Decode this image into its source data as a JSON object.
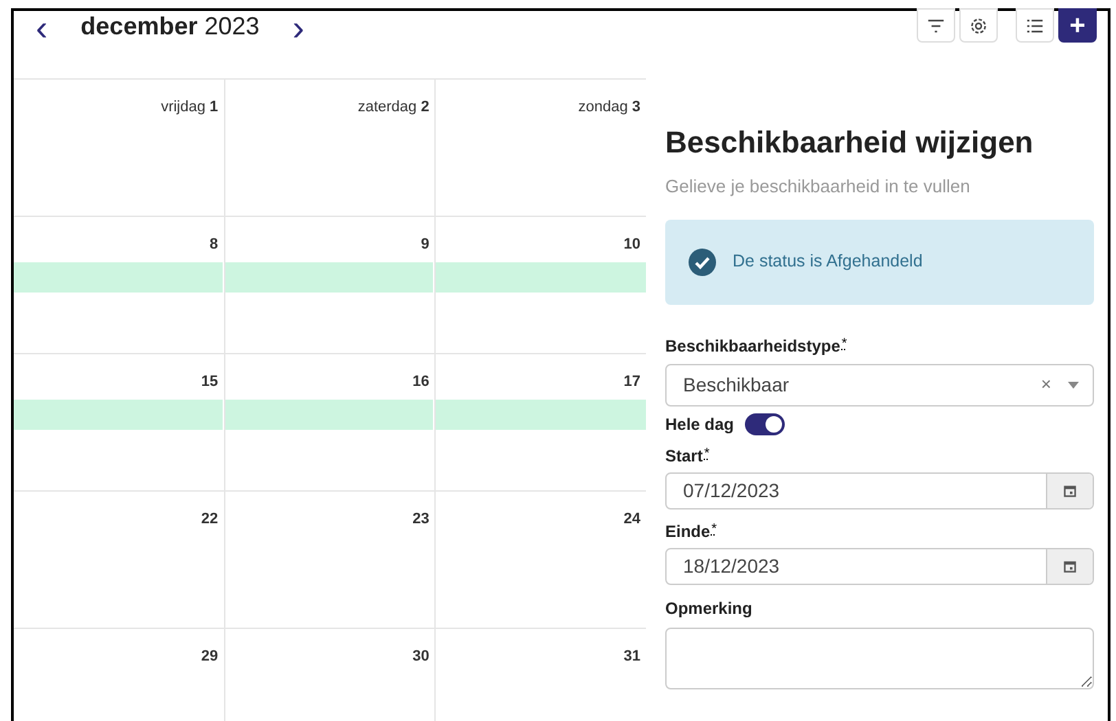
{
  "header": {
    "prev": "‹",
    "month": "december",
    "year": "2023",
    "next": "›"
  },
  "toolbar": [
    {
      "kind": "filter"
    },
    {
      "kind": "settings"
    },
    {
      "kind": "list"
    },
    {
      "kind": "add",
      "label": "+"
    }
  ],
  "weeks": [
    {
      "event": false,
      "days": [
        {
          "name": "vrijdag",
          "number": "1"
        },
        {
          "name": "zaterdag",
          "number": "2"
        },
        {
          "name": "zondag",
          "number": "3"
        }
      ]
    },
    {
      "event": true,
      "days": [
        {
          "number": "8"
        },
        {
          "number": "9"
        },
        {
          "number": "10"
        }
      ]
    },
    {
      "event": true,
      "days": [
        {
          "number": "15"
        },
        {
          "number": "16"
        },
        {
          "number": "17"
        }
      ]
    },
    {
      "event": false,
      "days": [
        {
          "number": "22"
        },
        {
          "number": "23"
        },
        {
          "number": "24"
        }
      ]
    },
    {
      "event": false,
      "days": [
        {
          "number": "29"
        },
        {
          "number": "30"
        },
        {
          "number": "31"
        }
      ]
    }
  ],
  "panel": {
    "title": "Beschikbaarheid wijzigen",
    "subtitle": "Gelieve je beschikbaarheid in te vullen",
    "alert": "De status is Afgehandeld",
    "type_field": {
      "label": "Beschikbaarheidstype",
      "required_mark": "*",
      "value": "Beschikbaar",
      "clear": "×"
    },
    "whole_day": {
      "label": "Hele dag",
      "on": true
    },
    "start": {
      "label": "Start",
      "required_mark": "*",
      "value": "07/12/2023"
    },
    "end": {
      "label": "Einde",
      "required_mark": "*",
      "value": "18/12/2023"
    },
    "remark": {
      "label": "Opmerking"
    }
  }
}
